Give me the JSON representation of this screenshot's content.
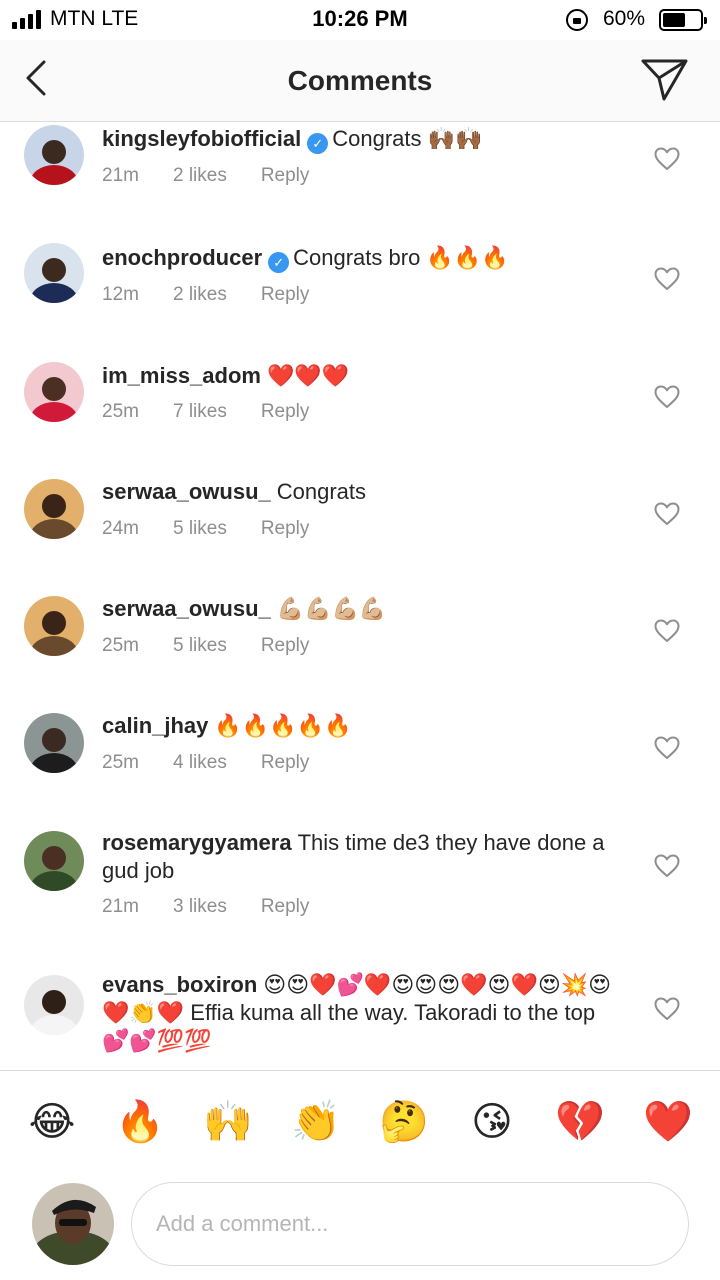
{
  "status_bar": {
    "carrier": "MTN  LTE",
    "time": "10:26 PM",
    "battery_pct": "60%",
    "battery_level": 0.6
  },
  "header": {
    "title": "Comments",
    "back_icon": "chevron-left-icon",
    "send_icon": "paper-plane-icon"
  },
  "comments": [
    {
      "username": "kingsleyfobiofficial",
      "verified": true,
      "text": "Congrats 🙌🏾🙌🏾",
      "time": "21m",
      "likes": "2 likes",
      "reply": "Reply"
    },
    {
      "username": "enochproducer",
      "verified": true,
      "text": "Congrats bro 🔥🔥🔥",
      "time": "12m",
      "likes": "2 likes",
      "reply": "Reply"
    },
    {
      "username": "im_miss_adom",
      "verified": false,
      "text": "❤️❤️❤️",
      "time": "25m",
      "likes": "7 likes",
      "reply": "Reply"
    },
    {
      "username": "serwaa_owusu_",
      "verified": false,
      "text": "Congrats",
      "time": "24m",
      "likes": "5 likes",
      "reply": "Reply"
    },
    {
      "username": "serwaa_owusu_",
      "verified": false,
      "text": "💪🏼💪🏼💪🏼💪🏼",
      "time": "25m",
      "likes": "5 likes",
      "reply": "Reply"
    },
    {
      "username": "calin_jhay",
      "verified": false,
      "text": "🔥🔥🔥🔥🔥",
      "time": "25m",
      "likes": "4 likes",
      "reply": "Reply"
    },
    {
      "username": "rosemarygyamera",
      "verified": false,
      "text": "This time de3 they have done a gud job",
      "time": "21m",
      "likes": "3 likes",
      "reply": "Reply"
    },
    {
      "username": "evans_boxiron",
      "verified": false,
      "text": "😍😍❤️💕❤️😍😍😍❤️😍❤️😍💥😍❤️👏❤️ Effia kuma all the way. Takoradi to the top💕💕💯💯",
      "time": "",
      "likes": "",
      "reply": ""
    }
  ],
  "quick_reactions": [
    "😂",
    "🔥",
    "🙌",
    "👏",
    "🤔",
    "😘",
    "💔",
    "❤️"
  ],
  "composer": {
    "placeholder": "Add a comment..."
  },
  "colors": {
    "verified": "#3897f0",
    "meta_text": "#8e8e8e",
    "divider": "#dbdbdb"
  }
}
